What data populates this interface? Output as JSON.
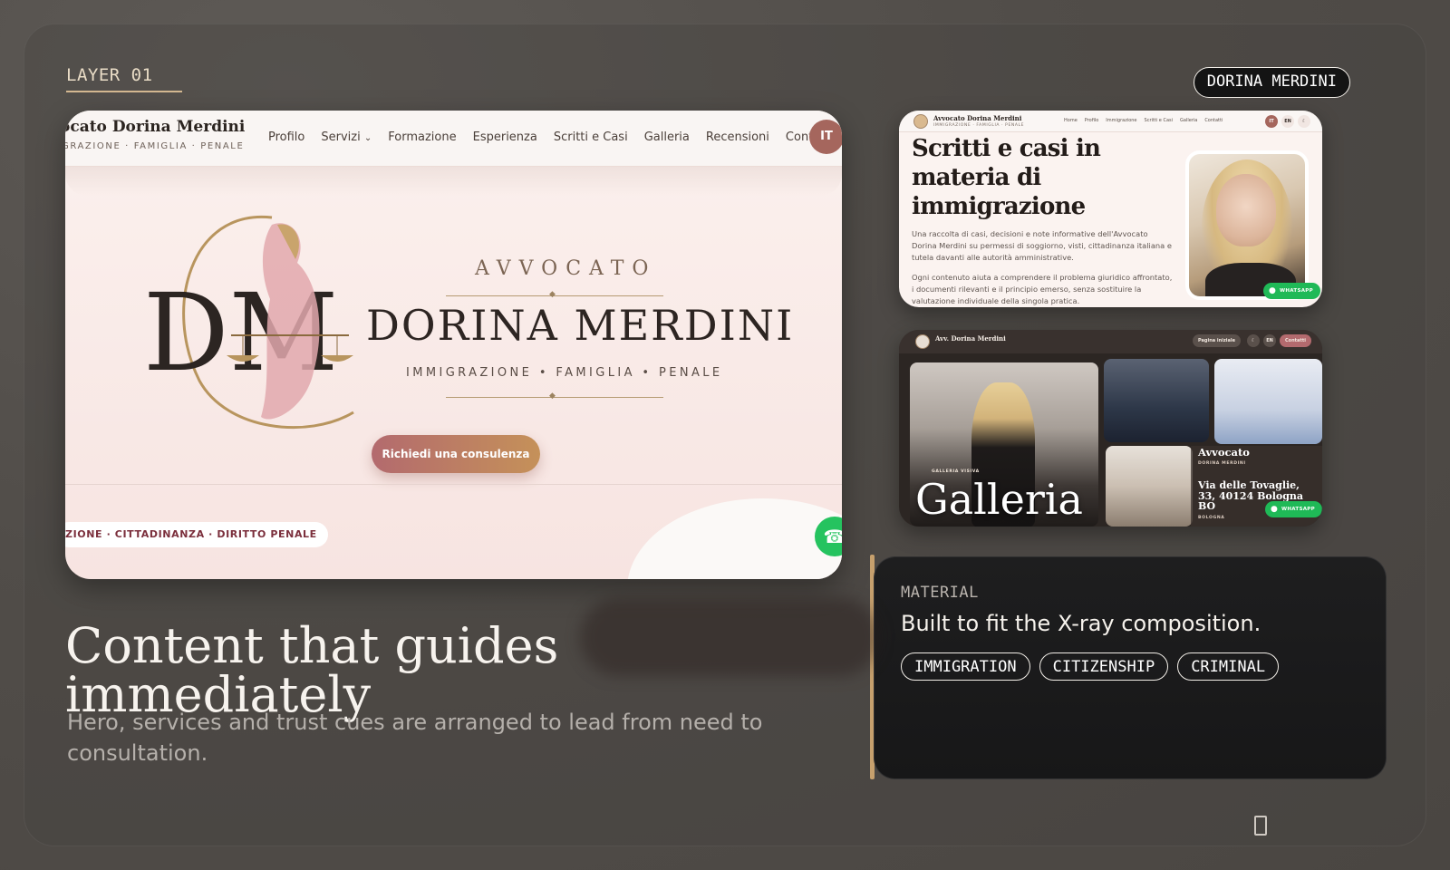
{
  "layer": {
    "label": "LAYER 01"
  },
  "badge": {
    "name": "DORINA MERDINI"
  },
  "site": {
    "brand": "ocato Dorina Merdini",
    "brand_sub": "GRAZIONE · FAMIGLIA · PENALE",
    "nav": [
      "Profilo",
      "Servizi",
      "Formazione",
      "Esperienza",
      "Scritti e Casi",
      "Galleria",
      "Recensioni",
      "Contatti"
    ],
    "lang": "IT",
    "hero_eyebrow": "AVVOCATO",
    "hero_name": "DORINA MERDINI",
    "hero_tags": "IMMIGRAZIONE • FAMIGLIA • PENALE",
    "cta": "Richiedi una consulenza",
    "ticker": "ZIONE · CITTADINANZA · DIRITTO PENALE",
    "logo_letters": "DM"
  },
  "thumb1": {
    "brand": "Avvocato Dorina Merdini",
    "brand_sub": "IMMIGRAZIONE · FAMIGLIA · PENALE",
    "nav": [
      "Home",
      "Profilo",
      "Immigrazione",
      "Scritti e Casi",
      "Galleria",
      "Contatti"
    ],
    "lang_it": "IT",
    "lang_en": "EN",
    "title": "Scritti e casi in materia di immigrazione",
    "p1": "Una raccolta di casi, decisioni e note informative dell'Avvocato Dorina Merdini su permessi di soggiorno, visti, cittadinanza italiana e tutela davanti alle autorità amministrative.",
    "p2": "Ogni contenuto aiuta a comprendere il problema giuridico affrontato, i documenti rilevanti e il principio emerso, senza sostituire la valutazione individuale della singola pratica.",
    "whatsapp": "WHATSAPP"
  },
  "thumb2": {
    "brand": "Avv. Dorina Merdini",
    "home": "Pagina iniziale",
    "lang_en": "EN",
    "contact": "Contatti",
    "kicker": "GALLERIA VISIVA",
    "title": "Galleria",
    "card_title": "Avvocato",
    "card_sub": "DORINA MERDINI",
    "card_addr": "Via delle Tovaglie, 33, 40124 Bologna BO",
    "card_city": "BOLOGNA",
    "whatsapp": "WHATSAPP"
  },
  "material": {
    "eyebrow": "MATERIAL",
    "title": "Built to fit the X-ray composition.",
    "tags": [
      "IMMIGRATION",
      "CITIZENSHIP",
      "CRIMINAL"
    ]
  },
  "copy": {
    "headline": "Content that guides immediately",
    "subline": "Hero, services and trust cues are arranged to lead from need to consultation."
  },
  "colors": {
    "accent": "#c6a06d",
    "cta_start": "#b36a6e",
    "cta_end": "#c59159",
    "whatsapp": "#25c35f",
    "panel": "#1e1e1f"
  }
}
